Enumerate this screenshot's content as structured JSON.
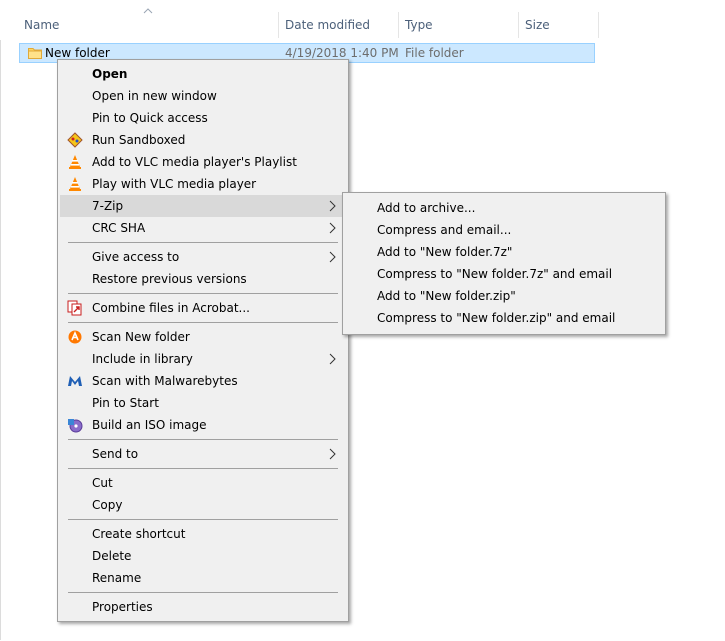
{
  "columns": {
    "name": "Name",
    "date_modified": "Date modified",
    "type": "Type",
    "size": "Size"
  },
  "file": {
    "name": "New folder",
    "date_modified": "4/19/2018 1:40 PM",
    "type": "File folder"
  },
  "context_menu": {
    "items": [
      {
        "label": "Open",
        "icon": null
      },
      {
        "label": "Open in new window",
        "icon": null
      },
      {
        "label": "Pin to Quick access",
        "icon": null
      },
      {
        "label": "Run Sandboxed",
        "icon": "sandboxie-icon"
      },
      {
        "label": "Add to VLC media player's Playlist",
        "icon": "vlc-cone-icon"
      },
      {
        "label": "Play with VLC media player",
        "icon": "vlc-cone-icon"
      },
      {
        "label": "7-Zip",
        "submenu": true,
        "highlighted": true
      },
      {
        "label": "CRC SHA",
        "submenu": true
      },
      {
        "label": "Give access to",
        "submenu": true
      },
      {
        "label": "Restore previous versions"
      },
      {
        "label": "Combine files in Acrobat...",
        "icon": "acrobat-combine-icon"
      },
      {
        "label": "Scan New folder",
        "icon": "avast-icon"
      },
      {
        "label": "Include in library",
        "submenu": true
      },
      {
        "label": "Scan with Malwarebytes",
        "icon": "malwarebytes-icon"
      },
      {
        "label": "Pin to Start"
      },
      {
        "label": "Build an ISO image",
        "icon": "iso-disc-icon"
      },
      {
        "label": "Send to",
        "submenu": true
      },
      {
        "label": "Cut"
      },
      {
        "label": "Copy"
      },
      {
        "label": "Create shortcut"
      },
      {
        "label": "Delete"
      },
      {
        "label": "Rename"
      },
      {
        "label": "Properties"
      }
    ]
  },
  "zip_submenu": {
    "items": [
      {
        "label": "Add to archive..."
      },
      {
        "label": "Compress and email..."
      },
      {
        "label": "Add to \"New folder.7z\""
      },
      {
        "label": "Compress to \"New folder.7z\" and email"
      },
      {
        "label": "Add to \"New folder.zip\""
      },
      {
        "label": "Compress to \"New folder.zip\" and email"
      }
    ]
  },
  "colors": {
    "selection_bg": "#cce8ff",
    "selection_border": "#99d1ff",
    "menu_bg": "#f0f0f0",
    "menu_hover": "#d9d9d9",
    "header_text": "#4c607a",
    "folder_yellow": "#ffd561"
  }
}
